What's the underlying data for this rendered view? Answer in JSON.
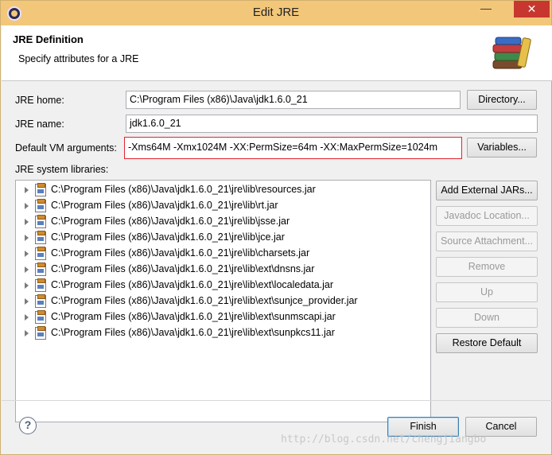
{
  "window": {
    "title": "Edit JRE",
    "minimize_glyph": "—",
    "close_glyph": "✕"
  },
  "header": {
    "title": "JRE Definition",
    "subtitle": "Specify attributes for a JRE",
    "icon": "library-books-icon"
  },
  "form": {
    "jre_home_label": "JRE home:",
    "jre_home_value": "C:\\Program Files (x86)\\Java\\jdk1.6.0_21",
    "jre_name_label": "JRE name:",
    "jre_name_value": "jdk1.6.0_21",
    "vm_args_label": "Default VM arguments:",
    "vm_args_value": "-Xms64M -Xmx1024M -XX:PermSize=64m -XX:MaxPermSize=1024m",
    "directory_button": "Directory...",
    "variables_button": "Variables...",
    "libraries_label": "JRE system libraries:"
  },
  "libraries": [
    "C:\\Program Files (x86)\\Java\\jdk1.6.0_21\\jre\\lib\\resources.jar",
    "C:\\Program Files (x86)\\Java\\jdk1.6.0_21\\jre\\lib\\rt.jar",
    "C:\\Program Files (x86)\\Java\\jdk1.6.0_21\\jre\\lib\\jsse.jar",
    "C:\\Program Files (x86)\\Java\\jdk1.6.0_21\\jre\\lib\\jce.jar",
    "C:\\Program Files (x86)\\Java\\jdk1.6.0_21\\jre\\lib\\charsets.jar",
    "C:\\Program Files (x86)\\Java\\jdk1.6.0_21\\jre\\lib\\ext\\dnsns.jar",
    "C:\\Program Files (x86)\\Java\\jdk1.6.0_21\\jre\\lib\\ext\\localedata.jar",
    "C:\\Program Files (x86)\\Java\\jdk1.6.0_21\\jre\\lib\\ext\\sunjce_provider.jar",
    "C:\\Program Files (x86)\\Java\\jdk1.6.0_21\\jre\\lib\\ext\\sunmscapi.jar",
    "C:\\Program Files (x86)\\Java\\jdk1.6.0_21\\jre\\lib\\ext\\sunpkcs11.jar"
  ],
  "side_buttons": {
    "add_external_jars": "Add External JARs...",
    "javadoc_location": "Javadoc Location...",
    "source_attachment": "Source Attachment...",
    "remove": "Remove",
    "up": "Up",
    "down": "Down",
    "restore_default": "Restore Default"
  },
  "footer": {
    "help_glyph": "?",
    "finish_button": "Finish",
    "cancel_button": "Cancel",
    "watermark": "http://blog.csdn.net/chengjiangbo"
  },
  "colors": {
    "titlebar": "#f2c77a",
    "close": "#c7372f",
    "highlight_border": "#e0262f"
  }
}
